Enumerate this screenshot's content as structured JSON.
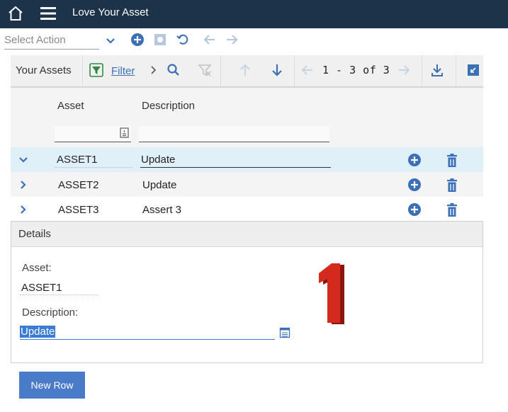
{
  "app": {
    "title": "Love Your Asset"
  },
  "actionbar": {
    "select_placeholder": "Select Action"
  },
  "toolbar": {
    "label": "Your Assets",
    "filter_label": "Filter",
    "pager": "1 - 3 of 3"
  },
  "table": {
    "columns": [
      "Asset",
      "Description"
    ],
    "rows": [
      {
        "asset": "ASSET1",
        "description": "Update",
        "expanded": true
      },
      {
        "asset": "ASSET2",
        "description": "Update",
        "expanded": false
      },
      {
        "asset": "ASSET3",
        "description": "Assert 3",
        "expanded": false
      }
    ]
  },
  "details": {
    "title": "Details",
    "asset_label": "Asset:",
    "asset_value": "ASSET1",
    "description_label": "Description:",
    "description_value": "Update",
    "overlay_number": "1"
  },
  "buttons": {
    "new_row": "New Row"
  },
  "colors": {
    "header_bg": "#1d3349",
    "accent": "#3b6fb6",
    "selected_row": "#dff0f8",
    "primary_button": "#4a7bc8",
    "overlay_red": "#d42a1e"
  }
}
